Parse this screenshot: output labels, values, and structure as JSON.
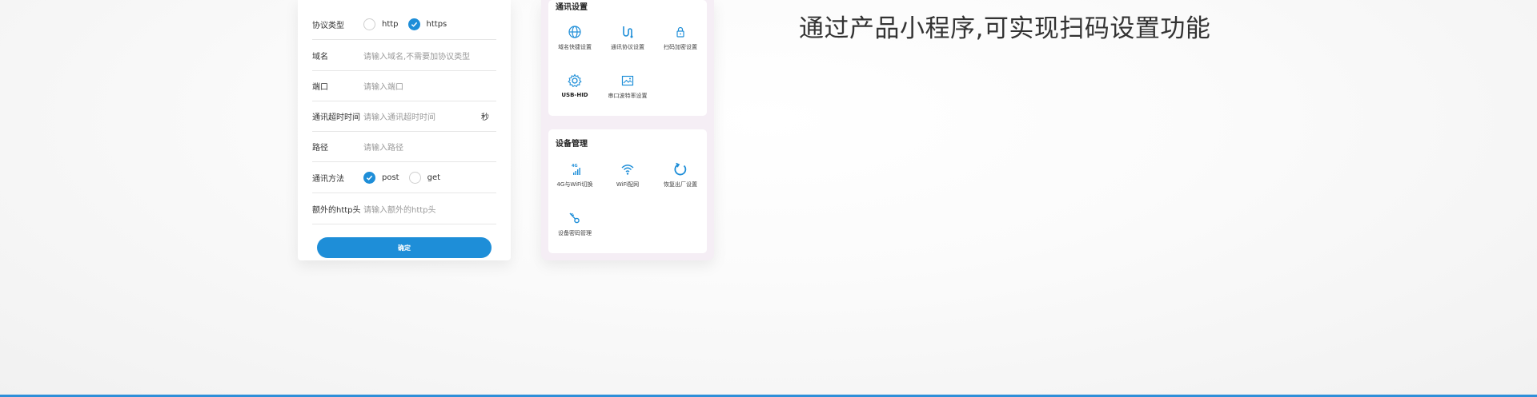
{
  "form": {
    "protocol_label": "协议类型",
    "protocol_options": [
      "http",
      "https"
    ],
    "protocol_selected": "https",
    "domain_label": "域名",
    "domain_placeholder": "请输入域名,不需要加协议类型",
    "port_label": "端口",
    "port_placeholder": "请输入端口",
    "timeout_label": "通讯超时时间",
    "timeout_placeholder": "请输入通讯超时时间",
    "timeout_unit": "秒",
    "path_label": "路径",
    "path_placeholder": "请输入路径",
    "method_label": "通讯方法",
    "method_options": [
      "post",
      "get"
    ],
    "method_selected": "post",
    "header_label": "额外的http头",
    "header_placeholder": "请输入额外的http头",
    "submit_label": "确定"
  },
  "settings": {
    "comm_title": "通讯设置",
    "comm_items": [
      {
        "label": "域名快捷设置",
        "icon": "globe-icon"
      },
      {
        "label": "通讯协议设置",
        "icon": "protocol-icon"
      },
      {
        "label": "扫码加密设置",
        "icon": "lock-icon"
      },
      {
        "label": "USB-HID",
        "icon": "gear-icon"
      },
      {
        "label": "串口波特率设置",
        "icon": "image-icon"
      }
    ],
    "device_title": "设备管理",
    "device_items": [
      {
        "label": "4G与WiFi切换",
        "icon": "signal-4g-icon"
      },
      {
        "label": "WiFi配网",
        "icon": "wifi-icon"
      },
      {
        "label": "恢复出厂设置",
        "icon": "reset-icon"
      },
      {
        "label": "设备密码管理",
        "icon": "key-icon"
      }
    ],
    "icon_color": "#1e8ed8"
  },
  "headline": "通过产品小程序,可实现扫码设置功能",
  "colors": {
    "accent": "#1e8ed8",
    "bottom_line": "#2f8fd8"
  }
}
